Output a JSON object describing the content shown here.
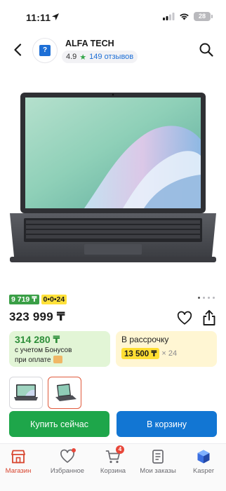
{
  "status_bar": {
    "time": "11:11",
    "battery": "28"
  },
  "header": {
    "store_name": "ALFA TECH",
    "rating": "4.9",
    "reviews": "149 отзывов"
  },
  "badges": {
    "monthly_text": "9 719 ₸",
    "installment_text": "0•0•24"
  },
  "product": {
    "price": "323 999 ₸"
  },
  "bonus_card": {
    "price": "314 280 ₸",
    "note_line1": "с учетом Бонусов",
    "note_line2": "при оплате"
  },
  "credit_card": {
    "title": "В рассрочку",
    "amount": "13 500 ₸",
    "term": "× 24"
  },
  "actions": {
    "buy_label": "Купить сейчас",
    "cart_label": "В корзину"
  },
  "tabbar": {
    "tabs": [
      {
        "label": "Магазин",
        "icon": "store-icon"
      },
      {
        "label": "Избранное",
        "icon": "heart-icon"
      },
      {
        "label": "Корзина",
        "icon": "cart-icon",
        "badge": "4"
      },
      {
        "label": "Мои заказы",
        "icon": "orders-icon"
      },
      {
        "label": "Kasper",
        "icon": "kasper-icon"
      }
    ]
  },
  "colors": {
    "green": "#1ea64a",
    "blue": "#1276d3",
    "yellow": "#ffdf33",
    "accent_red": "#d8452f"
  }
}
